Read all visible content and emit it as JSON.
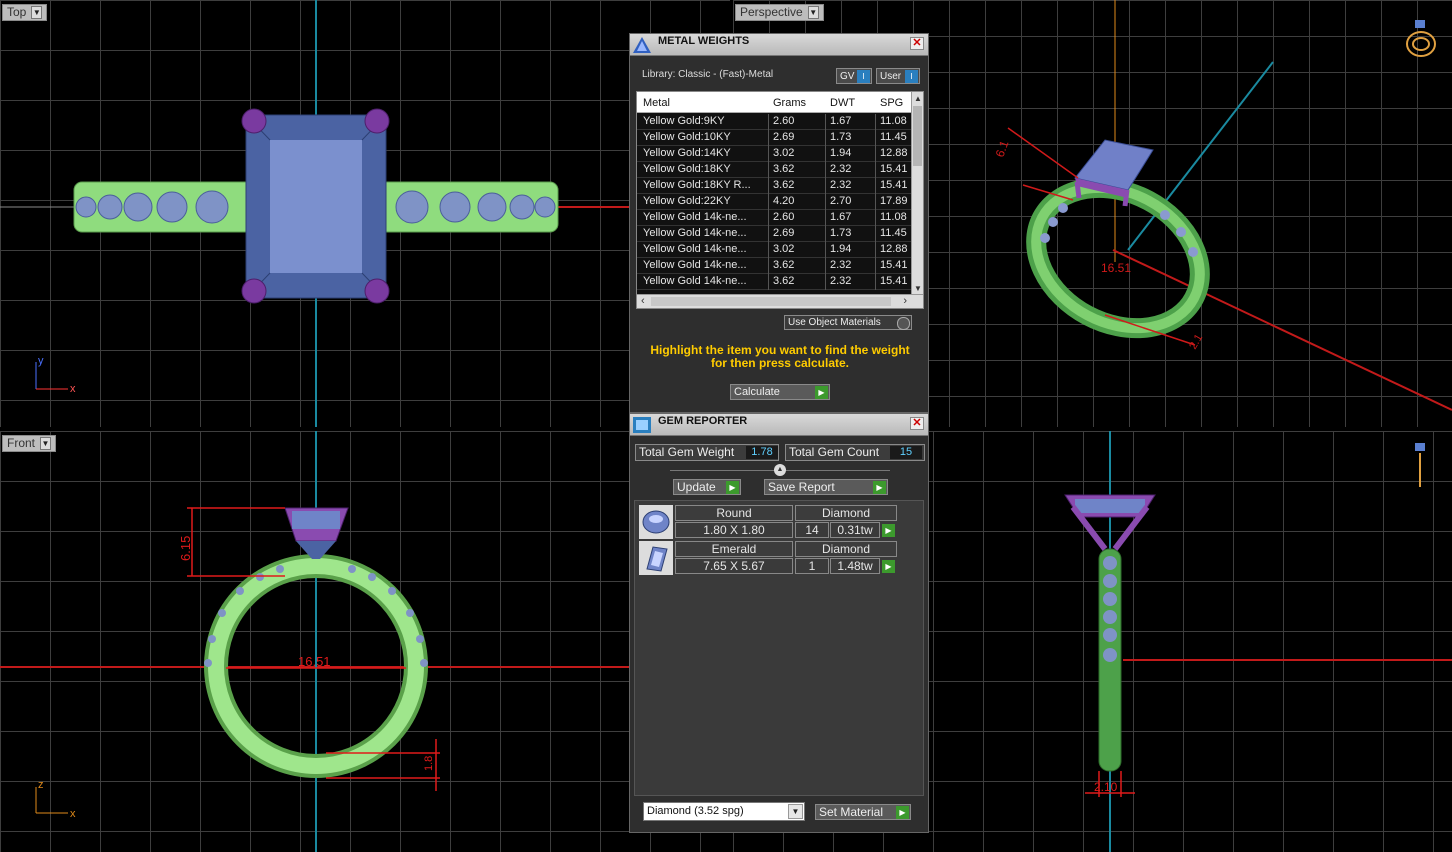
{
  "viewports": {
    "top": {
      "label": "Top",
      "axis_y": "y",
      "axis_x": "x"
    },
    "perspective": {
      "label": "Perspective",
      "dims": [
        "6.1",
        "16.51",
        "2.1"
      ]
    },
    "front": {
      "label": "Front",
      "axis_y": "z",
      "axis_x": "x",
      "dims": [
        "6.15",
        "16.51",
        "1.8"
      ]
    },
    "right": {
      "dims": [
        "2.10"
      ]
    }
  },
  "metal_weights": {
    "title": "METAL WEIGHTS",
    "library": "Library: Classic - (Fast)-Metal",
    "gv_label": "GV",
    "user_label": "User",
    "columns": [
      "Metal",
      "Grams",
      "DWT",
      "SPG"
    ],
    "rows": [
      [
        "Yellow Gold:9KY",
        "2.60",
        "1.67",
        "11.08"
      ],
      [
        "Yellow Gold:10KY",
        "2.69",
        "1.73",
        "11.45"
      ],
      [
        "Yellow Gold:14KY",
        "3.02",
        "1.94",
        "12.88"
      ],
      [
        "Yellow Gold:18KY",
        "3.62",
        "2.32",
        "15.41"
      ],
      [
        "Yellow Gold:18KY R...",
        "3.62",
        "2.32",
        "15.41"
      ],
      [
        "Yellow Gold:22KY",
        "4.20",
        "2.70",
        "17.89"
      ],
      [
        "Yellow Gold 14k-ne...",
        "2.60",
        "1.67",
        "11.08"
      ],
      [
        "Yellow Gold 14k-ne...",
        "2.69",
        "1.73",
        "11.45"
      ],
      [
        "Yellow Gold 14k-ne...",
        "3.02",
        "1.94",
        "12.88"
      ],
      [
        "Yellow Gold 14k-ne...",
        "3.62",
        "2.32",
        "15.41"
      ],
      [
        "Yellow Gold 14k-ne...",
        "3.62",
        "2.32",
        "15.41"
      ]
    ],
    "use_object_materials": "Use Object Materials",
    "instructions_line1": "Highlight the item you want to find the weight",
    "instructions_line2": "for then press calculate.",
    "calculate_label": "Calculate"
  },
  "gem_reporter": {
    "title": "GEM REPORTER",
    "total_weight_label": "Total Gem Weight",
    "total_weight_value": "1.78",
    "total_count_label": "Total Gem Count",
    "total_count_value": "15",
    "update_label": "Update",
    "save_report_label": "Save Report",
    "gems": [
      {
        "shape": "Round",
        "material": "Diamond",
        "size": "1.80 X 1.80",
        "count": "14",
        "weight": "0.31tw"
      },
      {
        "shape": "Emerald",
        "material": "Diamond",
        "size": "7.65 X 5.67",
        "count": "1",
        "weight": "1.48tw"
      }
    ],
    "material_select": "Diamond     (3.52 spg)",
    "set_material_label": "Set Material"
  },
  "colors": {
    "ring_green": "#8fdc7e",
    "gem_blue": "#6f84c8",
    "prong_purple": "#8a4bb0",
    "dimension_red": "#ff1a1a",
    "highlight_text": "#ffcc00"
  }
}
